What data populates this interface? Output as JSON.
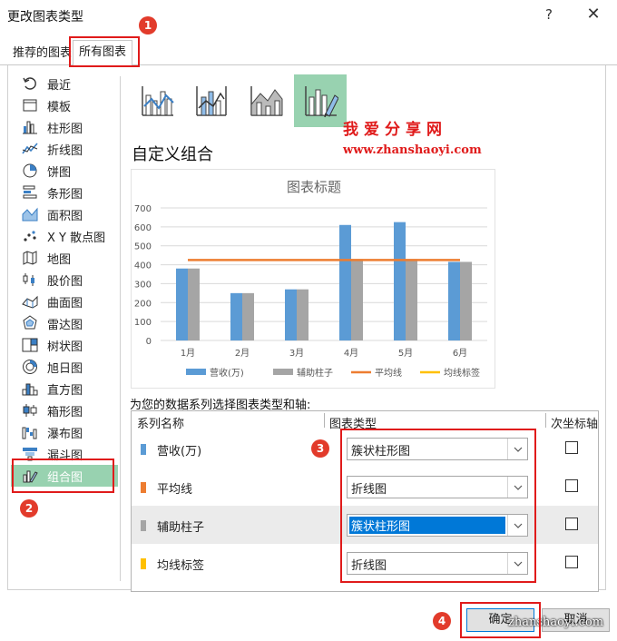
{
  "window": {
    "title": "更改图表类型",
    "help_glyph": "?",
    "close_glyph": "✕"
  },
  "tabs": [
    {
      "label": "推荐的图表"
    },
    {
      "label": "所有图表"
    }
  ],
  "sidebar": {
    "items": [
      {
        "label": "最近",
        "icon": "recent-icon"
      },
      {
        "label": "模板",
        "icon": "template-icon"
      },
      {
        "label": "柱形图",
        "icon": "column-chart-icon"
      },
      {
        "label": "折线图",
        "icon": "line-chart-icon"
      },
      {
        "label": "饼图",
        "icon": "pie-chart-icon"
      },
      {
        "label": "条形图",
        "icon": "bar-chart-icon"
      },
      {
        "label": "面积图",
        "icon": "area-chart-icon"
      },
      {
        "label": "X Y 散点图",
        "icon": "scatter-chart-icon"
      },
      {
        "label": "地图",
        "icon": "map-chart-icon"
      },
      {
        "label": "股价图",
        "icon": "stock-chart-icon"
      },
      {
        "label": "曲面图",
        "icon": "surface-chart-icon"
      },
      {
        "label": "雷达图",
        "icon": "radar-chart-icon"
      },
      {
        "label": "树状图",
        "icon": "treemap-chart-icon"
      },
      {
        "label": "旭日图",
        "icon": "sunburst-chart-icon"
      },
      {
        "label": "直方图",
        "icon": "histogram-chart-icon"
      },
      {
        "label": "箱形图",
        "icon": "boxplot-chart-icon"
      },
      {
        "label": "瀑布图",
        "icon": "waterfall-chart-icon"
      },
      {
        "label": "漏斗图",
        "icon": "funnel-chart-icon"
      },
      {
        "label": "组合图",
        "icon": "combo-chart-icon",
        "selected": true
      }
    ]
  },
  "subtypes": [
    {
      "icon": "combo-column-line-icon"
    },
    {
      "icon": "combo-column-line-secondary-icon"
    },
    {
      "icon": "combo-area-column-icon"
    },
    {
      "icon": "custom-combo-icon",
      "selected": true
    }
  ],
  "section_title": "自定义组合",
  "preview_chart": {
    "chart_data": {
      "type": "bar",
      "title": "图表标题",
      "categories": [
        "1月",
        "2月",
        "3月",
        "4月",
        "5月",
        "6月"
      ],
      "series": [
        {
          "name": "营收(万)",
          "kind": "bar",
          "color": "#5b9bd5",
          "values": [
            380,
            250,
            270,
            610,
            625,
            415
          ]
        },
        {
          "name": "辅助柱子",
          "kind": "bar",
          "color": "#a5a5a5",
          "values": [
            380,
            250,
            270,
            430,
            430,
            415
          ]
        },
        {
          "name": "平均线",
          "kind": "line",
          "color": "#ed7d31",
          "values": [
            425,
            425,
            425,
            425,
            425,
            425
          ]
        },
        {
          "name": "均线标签",
          "kind": "line",
          "color": "#ffc000",
          "values": []
        }
      ],
      "yticks": [
        "0",
        "100",
        "200",
        "300",
        "400",
        "500",
        "600",
        "700"
      ],
      "ylim": [
        0,
        700
      ],
      "grid": true,
      "legend": "bottom"
    }
  },
  "series_config": {
    "instruction": "为您的数据系列选择图表类型和轴:",
    "headers": {
      "name": "系列名称",
      "type": "图表类型",
      "secondary": "次坐标轴"
    },
    "rows": [
      {
        "name": "营收(万)",
        "color": "#5b9bd5",
        "type": "簇状柱形图",
        "secondary": false
      },
      {
        "name": "平均线",
        "color": "#ed7d31",
        "type": "折线图",
        "secondary": false
      },
      {
        "name": "辅助柱子",
        "color": "#a5a5a5",
        "type": "簇状柱形图",
        "secondary": false,
        "highlighted": true
      },
      {
        "name": "均线标签",
        "color": "#ffc000",
        "type": "折线图",
        "secondary": false
      }
    ]
  },
  "buttons": {
    "ok": "确定",
    "cancel": "取消"
  },
  "annotations": {
    "badges": [
      "1",
      "2",
      "3",
      "4"
    ]
  },
  "watermark": {
    "title": "我爱分享网",
    "url": "www.zhanshaoyi.com",
    "bottom": "zhanshaoyi.com"
  }
}
